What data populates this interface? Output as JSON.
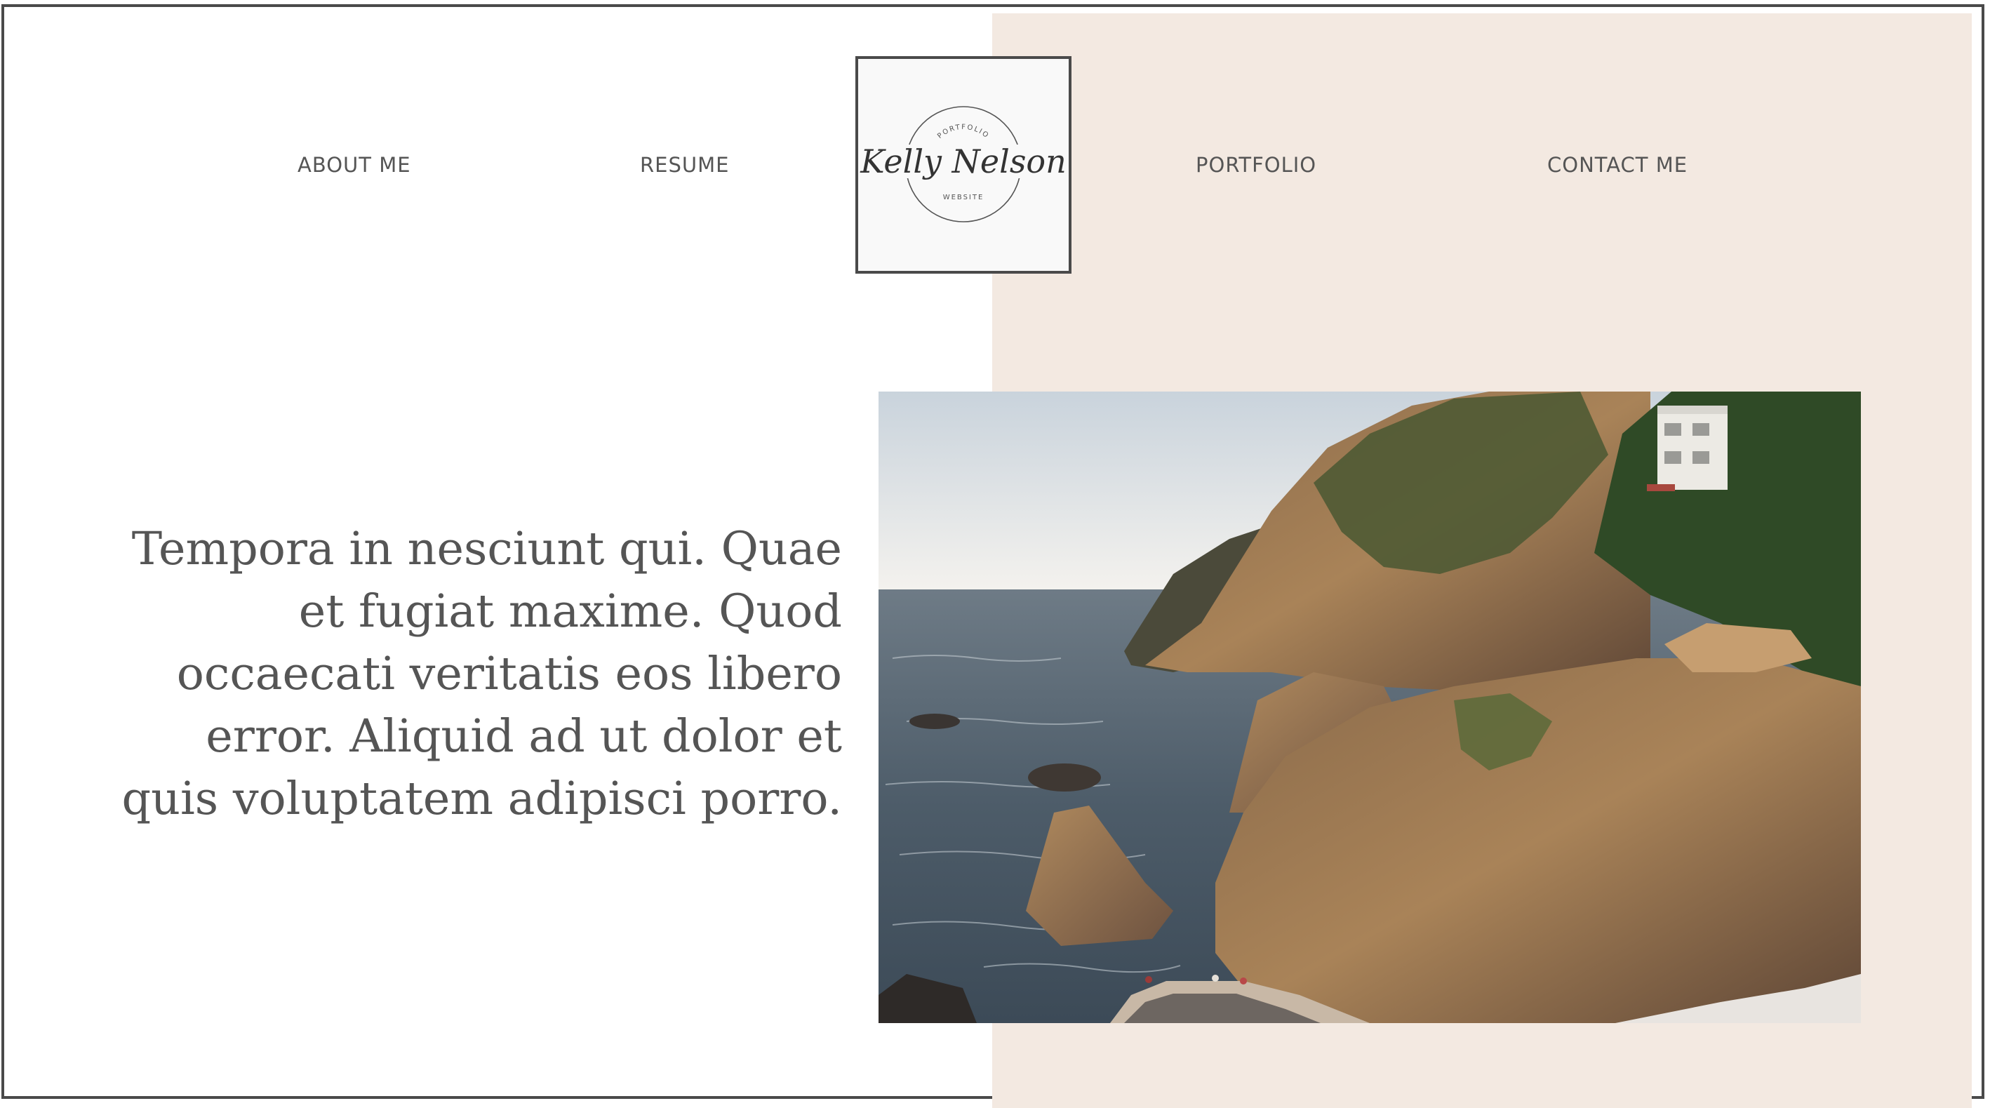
{
  "nav": {
    "about_label": "ABOUT ME",
    "resume_label": "RESUME",
    "portfolio_label": "PORTFOLIO",
    "contact_label": "CONTACT ME"
  },
  "logo": {
    "top_text": "PORTFOLIO",
    "name": "Kelly Nelson",
    "bottom_text": "WEBSITE"
  },
  "hero": {
    "quote": "Tempora in nesciunt qui. Quae et fugiat maxime. Quod occaecati veritatis eos libero error. Aliquid ad ut dolor et quis voluptatem adipisci porro."
  },
  "photo": {
    "subject": "coastal-cliffs"
  },
  "colors": {
    "beige": "#f3e9e1",
    "text": "#555555",
    "border": "#4a4a4a"
  }
}
